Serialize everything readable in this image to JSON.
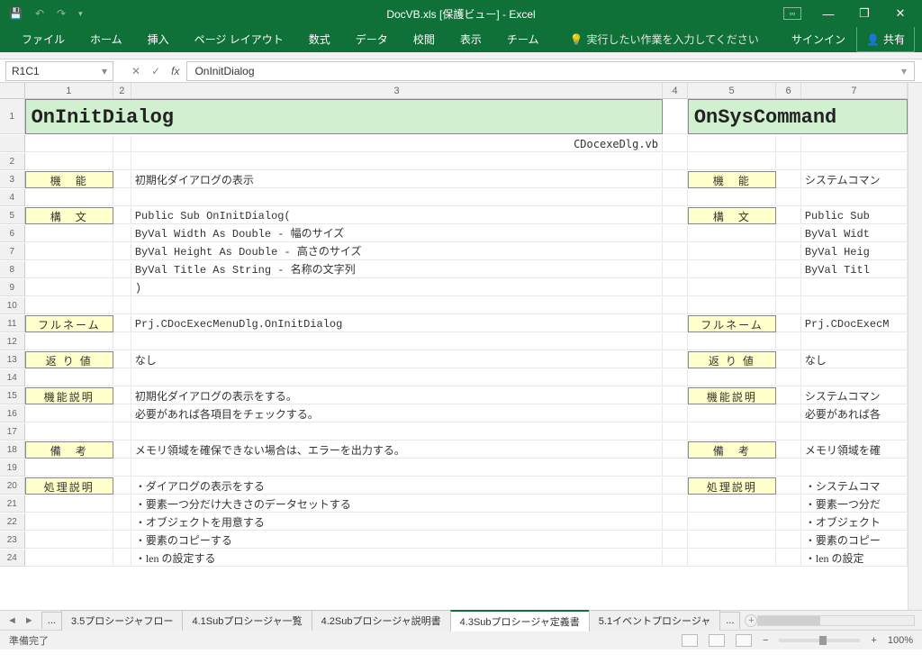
{
  "title": "DocVB.xls  [保護ビュー] - Excel",
  "ribbon": {
    "file": "ファイル",
    "home": "ホーム",
    "insert": "挿入",
    "layout": "ページ レイアウト",
    "formulas": "数式",
    "data": "データ",
    "review": "校閲",
    "view": "表示",
    "team": "チーム",
    "tell_me": "実行したい作業を入力してください",
    "signin": "サインイン",
    "share": "共有"
  },
  "namebox": "R1C1",
  "formula": "OnInitDialog",
  "col_headers": [
    "1",
    "2",
    "3",
    "4",
    "5",
    "6",
    "7"
  ],
  "main_title": "OnInitDialog",
  "side_title": "OnSysCommand",
  "sub_file": "CDocexeDlg.vb",
  "labels": {
    "func": "機　能",
    "syntax": "構　文",
    "fullname": "フルネーム",
    "return": "返 り 値",
    "funcdesc": "機能説明",
    "remark": "備　考",
    "procdesc": "処理説明"
  },
  "left": {
    "func": "初期化ダイアログの表示",
    "syntax0": "Public Sub OnInitDialog(",
    "syntax1": "  ByVal Width   As Double - 幅のサイズ",
    "syntax2": "  ByVal Height  As Double - 高さのサイズ",
    "syntax3": "  ByVal Title   As String - 名称の文字列",
    "syntax4": ")",
    "fullname": "Prj.CDocExecMenuDlg.OnInitDialog",
    "return": "なし",
    "funcdesc1": "初期化ダイアログの表示をする。",
    "funcdesc2": "必要があれば各項目をチェックする。",
    "remark": "メモリ領域を確保できない場合は、エラーを出力する。",
    "proc1": "・ダイアログの表示をする",
    "proc2": "・要素一つ分だけ大きさのデータセットする",
    "proc3": "・オブジェクトを用意する",
    "proc4": "・要素のコピーする",
    "proc5": "・len の設定する"
  },
  "right": {
    "func": "システムコマン",
    "syntax0": "Public Sub ",
    "syntax1": "  ByVal Widt",
    "syntax2": "  ByVal Heig",
    "syntax3": "  ByVal Titl",
    "fullname": "Prj.CDocExecM",
    "return": "なし",
    "funcdesc1": "システムコマン",
    "funcdesc2": "必要があれば各",
    "remark": "メモリ領域を確",
    "proc1": "・システムコマ",
    "proc2": "・要素一つ分だ",
    "proc3": "・オブジェクト",
    "proc4": "・要素のコピー",
    "proc5": "・len の設定"
  },
  "tabs": {
    "t0": "...",
    "t1": "3.5プロシージャフロー",
    "t2": "4.1Subプロシージャ一覧",
    "t3": "4.2Subプロシージャ説明書",
    "t4": "4.3Subプロシージャ定義書",
    "t5": "5.1イベントプロシージャ",
    "t6": "..."
  },
  "status": "準備完了",
  "zoom": "100%"
}
